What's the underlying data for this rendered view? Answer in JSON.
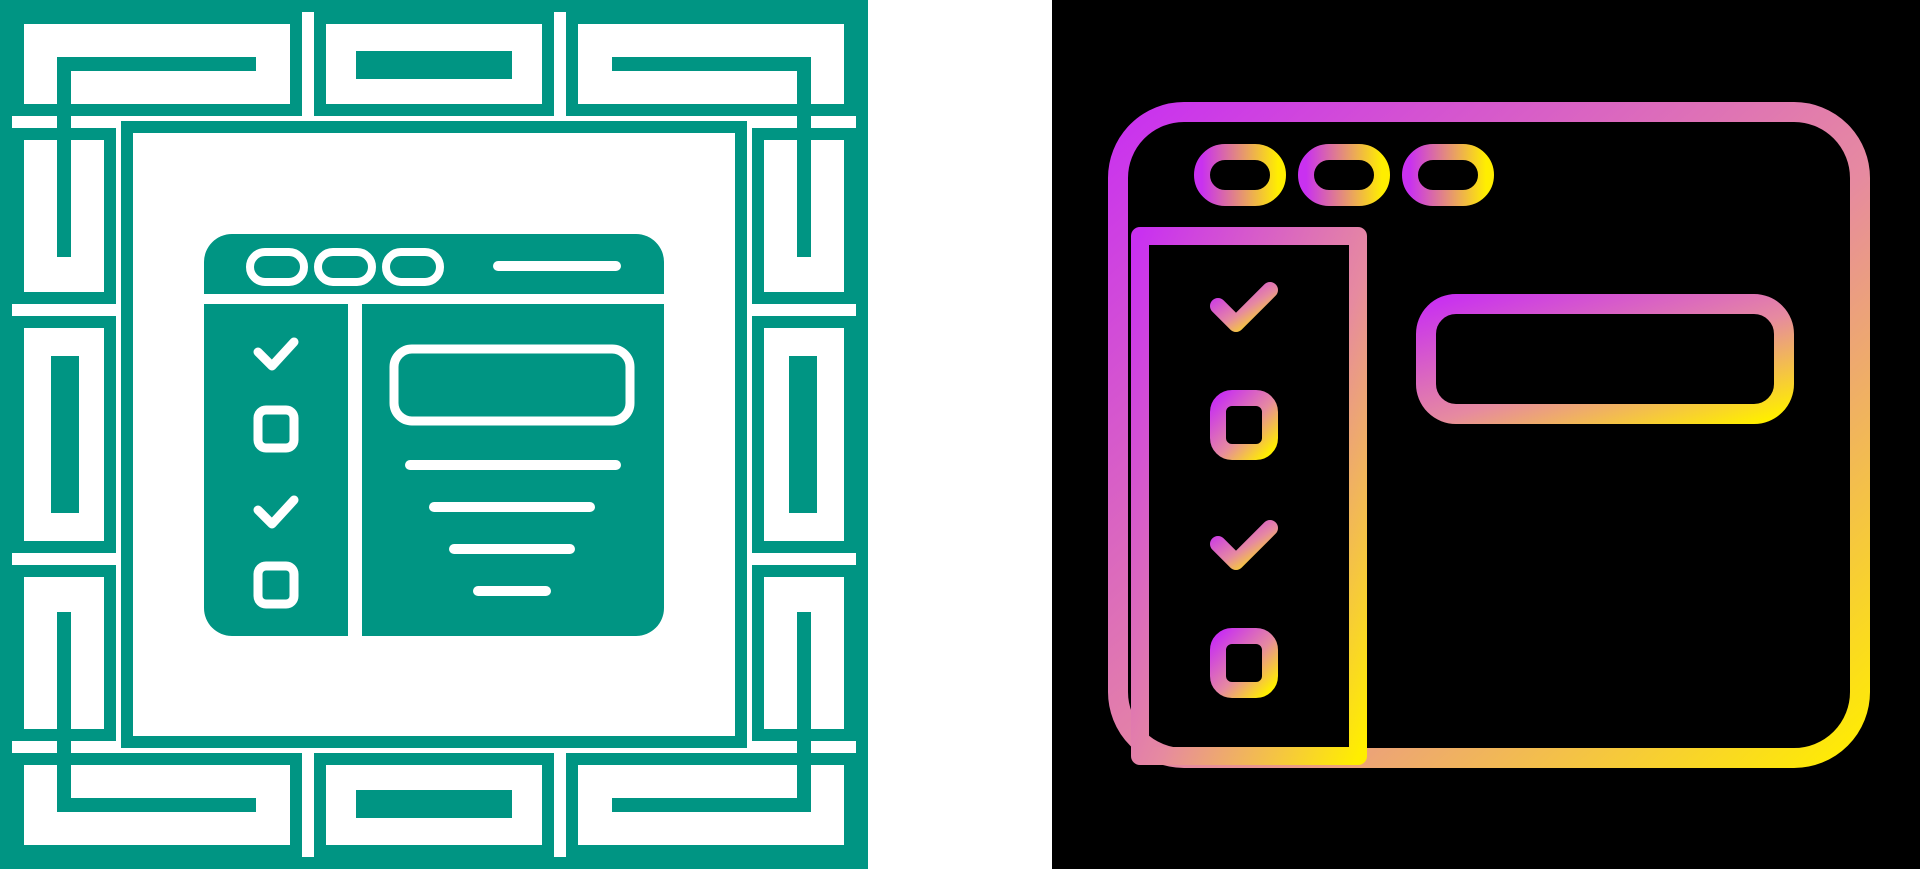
{
  "colors": {
    "teal": "#009583",
    "white": "#ffffff",
    "black": "#000000",
    "gradient_start": "#c931f0",
    "gradient_end": "#ffee00"
  },
  "icons": [
    {
      "name": "checklist-browser-glyph-icon",
      "style": "glyph",
      "frame": "teal-pattern-border",
      "checklist": [
        "checked",
        "unchecked",
        "checked",
        "unchecked"
      ]
    },
    {
      "name": "checklist-browser-gradient-outline-icon",
      "style": "outline-gradient",
      "frame": "none",
      "checklist": [
        "checked",
        "unchecked",
        "checked",
        "unchecked"
      ]
    }
  ]
}
